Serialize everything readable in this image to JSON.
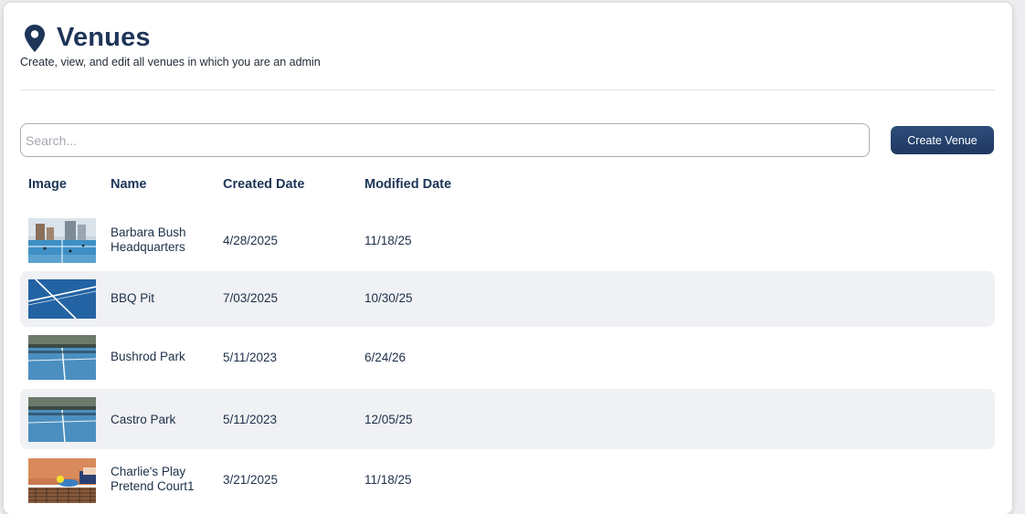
{
  "page": {
    "title": "Venues",
    "title_icon": "map-pin-icon",
    "subtitle": "Create, view, and edit all venues in which you are an admin"
  },
  "search": {
    "placeholder": "Search...",
    "value": ""
  },
  "actions": {
    "create_label": "Create Venue"
  },
  "table": {
    "columns": [
      "Image",
      "Name",
      "Created Date",
      "Modified Date"
    ],
    "rows": [
      {
        "name": "Barbara Bush Headquarters",
        "created": "4/28/2025",
        "modified": "11/18/25",
        "thumb": "city-courts"
      },
      {
        "name": "BBQ Pit",
        "created": "7/03/2025",
        "modified": "10/30/25",
        "thumb": "court-lines"
      },
      {
        "name": "Bushrod Park",
        "created": "5/11/2023",
        "modified": "6/24/26",
        "thumb": "park-court"
      },
      {
        "name": "Castro Park",
        "created": "5/11/2023",
        "modified": "12/05/25",
        "thumb": "park-court"
      },
      {
        "name": "Charlie's Play Pretend Court1",
        "created": "3/21/2025",
        "modified": "11/18/25",
        "thumb": "net-ball"
      }
    ]
  },
  "colors": {
    "primary": "#1d3557",
    "button": "#24416b",
    "row_alt": "#f0f1f4"
  }
}
